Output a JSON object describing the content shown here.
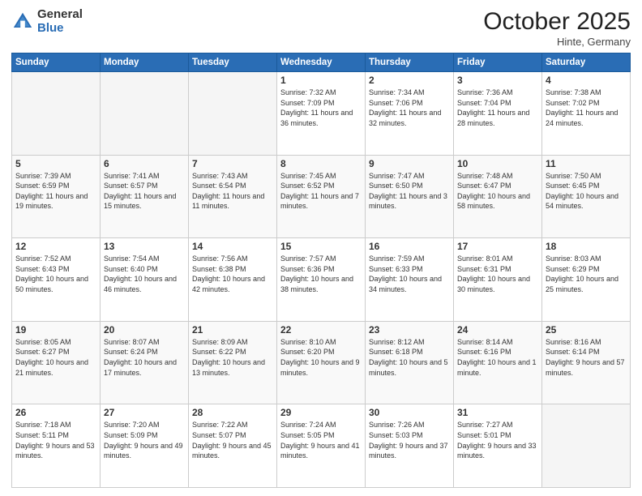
{
  "header": {
    "logo_general": "General",
    "logo_blue": "Blue",
    "month_title": "October 2025",
    "location": "Hinte, Germany"
  },
  "weekdays": [
    "Sunday",
    "Monday",
    "Tuesday",
    "Wednesday",
    "Thursday",
    "Friday",
    "Saturday"
  ],
  "weeks": [
    [
      {
        "day": "",
        "empty": true
      },
      {
        "day": "",
        "empty": true
      },
      {
        "day": "",
        "empty": true
      },
      {
        "day": "1",
        "sunrise": "7:32 AM",
        "sunset": "7:09 PM",
        "daylight": "11 hours and 36 minutes."
      },
      {
        "day": "2",
        "sunrise": "7:34 AM",
        "sunset": "7:06 PM",
        "daylight": "11 hours and 32 minutes."
      },
      {
        "day": "3",
        "sunrise": "7:36 AM",
        "sunset": "7:04 PM",
        "daylight": "11 hours and 28 minutes."
      },
      {
        "day": "4",
        "sunrise": "7:38 AM",
        "sunset": "7:02 PM",
        "daylight": "11 hours and 24 minutes."
      }
    ],
    [
      {
        "day": "5",
        "sunrise": "7:39 AM",
        "sunset": "6:59 PM",
        "daylight": "11 hours and 19 minutes."
      },
      {
        "day": "6",
        "sunrise": "7:41 AM",
        "sunset": "6:57 PM",
        "daylight": "11 hours and 15 minutes."
      },
      {
        "day": "7",
        "sunrise": "7:43 AM",
        "sunset": "6:54 PM",
        "daylight": "11 hours and 11 minutes."
      },
      {
        "day": "8",
        "sunrise": "7:45 AM",
        "sunset": "6:52 PM",
        "daylight": "11 hours and 7 minutes."
      },
      {
        "day": "9",
        "sunrise": "7:47 AM",
        "sunset": "6:50 PM",
        "daylight": "11 hours and 3 minutes."
      },
      {
        "day": "10",
        "sunrise": "7:48 AM",
        "sunset": "6:47 PM",
        "daylight": "10 hours and 58 minutes."
      },
      {
        "day": "11",
        "sunrise": "7:50 AM",
        "sunset": "6:45 PM",
        "daylight": "10 hours and 54 minutes."
      }
    ],
    [
      {
        "day": "12",
        "sunrise": "7:52 AM",
        "sunset": "6:43 PM",
        "daylight": "10 hours and 50 minutes."
      },
      {
        "day": "13",
        "sunrise": "7:54 AM",
        "sunset": "6:40 PM",
        "daylight": "10 hours and 46 minutes."
      },
      {
        "day": "14",
        "sunrise": "7:56 AM",
        "sunset": "6:38 PM",
        "daylight": "10 hours and 42 minutes."
      },
      {
        "day": "15",
        "sunrise": "7:57 AM",
        "sunset": "6:36 PM",
        "daylight": "10 hours and 38 minutes."
      },
      {
        "day": "16",
        "sunrise": "7:59 AM",
        "sunset": "6:33 PM",
        "daylight": "10 hours and 34 minutes."
      },
      {
        "day": "17",
        "sunrise": "8:01 AM",
        "sunset": "6:31 PM",
        "daylight": "10 hours and 30 minutes."
      },
      {
        "day": "18",
        "sunrise": "8:03 AM",
        "sunset": "6:29 PM",
        "daylight": "10 hours and 25 minutes."
      }
    ],
    [
      {
        "day": "19",
        "sunrise": "8:05 AM",
        "sunset": "6:27 PM",
        "daylight": "10 hours and 21 minutes."
      },
      {
        "day": "20",
        "sunrise": "8:07 AM",
        "sunset": "6:24 PM",
        "daylight": "10 hours and 17 minutes."
      },
      {
        "day": "21",
        "sunrise": "8:09 AM",
        "sunset": "6:22 PM",
        "daylight": "10 hours and 13 minutes."
      },
      {
        "day": "22",
        "sunrise": "8:10 AM",
        "sunset": "6:20 PM",
        "daylight": "10 hours and 9 minutes."
      },
      {
        "day": "23",
        "sunrise": "8:12 AM",
        "sunset": "6:18 PM",
        "daylight": "10 hours and 5 minutes."
      },
      {
        "day": "24",
        "sunrise": "8:14 AM",
        "sunset": "6:16 PM",
        "daylight": "10 hours and 1 minute."
      },
      {
        "day": "25",
        "sunrise": "8:16 AM",
        "sunset": "6:14 PM",
        "daylight": "9 hours and 57 minutes."
      }
    ],
    [
      {
        "day": "26",
        "sunrise": "7:18 AM",
        "sunset": "5:11 PM",
        "daylight": "9 hours and 53 minutes."
      },
      {
        "day": "27",
        "sunrise": "7:20 AM",
        "sunset": "5:09 PM",
        "daylight": "9 hours and 49 minutes."
      },
      {
        "day": "28",
        "sunrise": "7:22 AM",
        "sunset": "5:07 PM",
        "daylight": "9 hours and 45 minutes."
      },
      {
        "day": "29",
        "sunrise": "7:24 AM",
        "sunset": "5:05 PM",
        "daylight": "9 hours and 41 minutes."
      },
      {
        "day": "30",
        "sunrise": "7:26 AM",
        "sunset": "5:03 PM",
        "daylight": "9 hours and 37 minutes."
      },
      {
        "day": "31",
        "sunrise": "7:27 AM",
        "sunset": "5:01 PM",
        "daylight": "9 hours and 33 minutes."
      },
      {
        "day": "",
        "empty": true
      }
    ]
  ]
}
